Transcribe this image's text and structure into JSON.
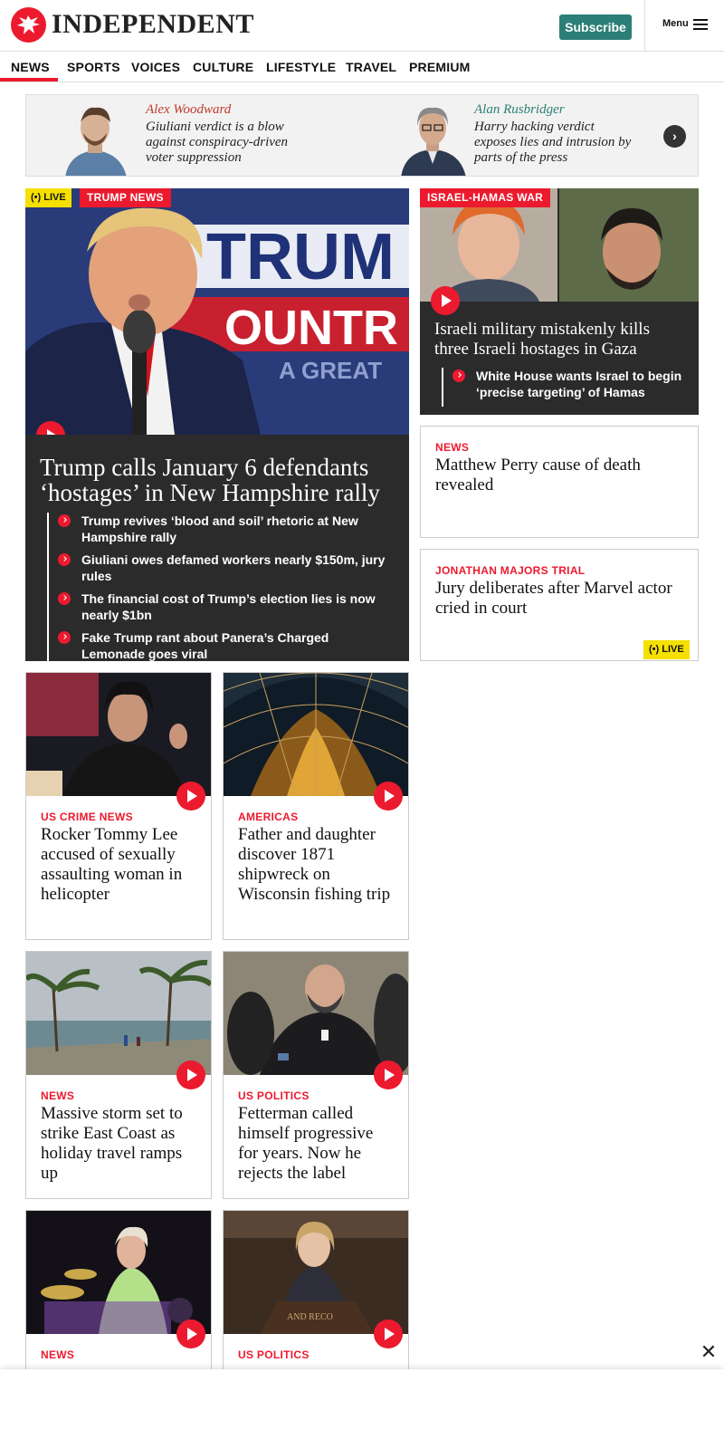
{
  "header": {
    "logo_text": "INDEPENDENT",
    "subscribe_label": "Subscribe",
    "menu_label": "Menu"
  },
  "nav": {
    "items": [
      "NEWS",
      "SPORTS",
      "VOICES",
      "CULTURE",
      "LIFESTYLE",
      "TRAVEL",
      "PREMIUM"
    ],
    "active": "NEWS"
  },
  "voices": [
    {
      "author": "Alex Woodward",
      "headline": "Giuliani verdict is a blow against conspiracy-driven voter suppression"
    },
    {
      "author": "Alan Rusbridger",
      "headline": "Harry hacking verdict exposes lies and intrusion by parts of the press"
    }
  ],
  "main_story": {
    "live_label": "LIVE",
    "tag": "TRUMP NEWS",
    "headline": "Trump calls January 6 defendants ‘hostages’ in New Hampshire rally",
    "related": [
      "Trump revives ‘blood and soil’ rhetoric at New Hampshire rally",
      "Giuliani owes defamed workers nearly $150m, jury rules",
      "The financial cost of Trump’s election lies is now nearly $1bn",
      "Fake Trump rant about Panera’s Charged Lemonade goes viral"
    ]
  },
  "israel_story": {
    "tag": "ISRAEL-HAMAS WAR",
    "headline": "Israeli military mistakenly kills three Israeli hostages in Gaza",
    "related": [
      "White House wants Israel to begin ‘precise targeting’ of Hamas"
    ]
  },
  "side_stories": [
    {
      "kicker": "NEWS",
      "headline": "Matthew Perry cause of death revealed"
    },
    {
      "kicker": "JONATHAN MAJORS TRIAL",
      "headline": "Jury deliberates after Marvel actor cried in court",
      "live_label": "LIVE"
    }
  ],
  "grid": [
    {
      "kicker": "US CRIME NEWS",
      "headline": "Rocker Tommy Lee accused of sexually assaulting woman in helicopter"
    },
    {
      "kicker": "AMERICAS",
      "headline": "Father and daughter discover 1871 shipwreck on Wisconsin fishing trip"
    },
    {
      "kicker": "NEWS",
      "headline": "Massive storm set to strike East Coast as holiday travel ramps up"
    },
    {
      "kicker": "US POLITICS",
      "headline": "Fetterman called himself progressive for years. Now he rejects the label"
    },
    {
      "kicker": "NEWS",
      "headline": ""
    },
    {
      "kicker": "US POLITICS",
      "headline": ""
    }
  ],
  "colors": {
    "brand_red": "#ec1a2e",
    "subscribe_green": "#2b7f76",
    "live_yellow": "#f5e000",
    "card_dark": "#2b2b2b"
  },
  "icons": [
    "eagle-logo-icon",
    "menu-icon",
    "chevron-right-icon",
    "play-icon",
    "live-broadcast-icon",
    "close-icon"
  ]
}
